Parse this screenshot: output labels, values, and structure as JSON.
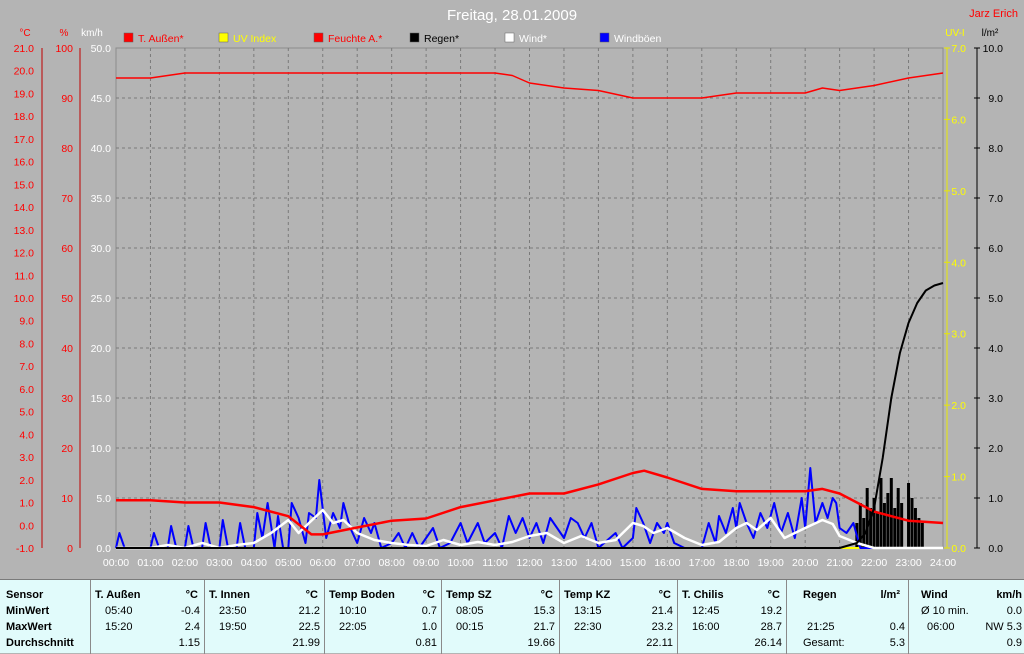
{
  "header": {
    "title": "Freitag, 28.01.2009",
    "author": "Jarz Erich"
  },
  "axes": {
    "temp_unit": "°C",
    "hum_unit": "%",
    "wind_unit": "km/h",
    "uv_unit": "UV-I",
    "rain_unit": "l/m²"
  },
  "chart_data": {
    "type": "line",
    "x": [
      "00:00",
      "01:00",
      "02:00",
      "03:00",
      "04:00",
      "05:00",
      "06:00",
      "07:00",
      "08:00",
      "09:00",
      "10:00",
      "11:00",
      "12:00",
      "13:00",
      "14:00",
      "15:00",
      "16:00",
      "17:00",
      "18:00",
      "19:00",
      "20:00",
      "21:00",
      "22:00",
      "23:00",
      "24:00"
    ],
    "temp_ticks": [
      "21.0",
      "20.0",
      "19.0",
      "18.0",
      "17.0",
      "16.0",
      "15.0",
      "14.0",
      "13.0",
      "12.0",
      "11.0",
      "10.0",
      "9.0",
      "8.0",
      "7.0",
      "6.0",
      "5.0",
      "4.0",
      "3.0",
      "2.0",
      "1.0",
      "0.0",
      "-1.0"
    ],
    "hum_ticks": [
      "100",
      "90",
      "80",
      "70",
      "60",
      "50",
      "40",
      "30",
      "20",
      "10",
      "0"
    ],
    "wind_ticks": [
      "50.0",
      "45.0",
      "40.0",
      "35.0",
      "30.0",
      "25.0",
      "20.0",
      "15.0",
      "10.0",
      "5.0",
      "0.0"
    ],
    "uv_ticks": [
      "7.0",
      "6.0",
      "5.0",
      "4.0",
      "3.0",
      "2.0",
      "1.0",
      "0.0"
    ],
    "rain_ticks": [
      "10.0",
      "9.0",
      "8.0",
      "7.0",
      "6.0",
      "5.0",
      "4.0",
      "3.0",
      "2.0",
      "1.0",
      "0.0"
    ],
    "ylim_wind": [
      0,
      50
    ],
    "ylim_temp": [
      -1,
      21
    ],
    "ylim_hum": [
      0,
      100
    ],
    "ylim_uv": [
      0,
      7
    ],
    "ylim_rain": [
      0,
      10
    ],
    "grid": true,
    "legend_position": "top",
    "series": [
      {
        "name": "T. Außen*",
        "color": "#ff0000",
        "axis": "temp",
        "points": [
          [
            0,
            1.1
          ],
          [
            1,
            1.1
          ],
          [
            2,
            1.0
          ],
          [
            3,
            1.0
          ],
          [
            4,
            0.8
          ],
          [
            5,
            0.4
          ],
          [
            5.67,
            -0.4
          ],
          [
            6,
            -0.4
          ],
          [
            7,
            -0.1
          ],
          [
            8,
            0.2
          ],
          [
            9,
            0.3
          ],
          [
            10,
            0.8
          ],
          [
            11,
            1.1
          ],
          [
            12,
            1.4
          ],
          [
            13,
            1.4
          ],
          [
            14,
            1.8
          ],
          [
            15,
            2.3
          ],
          [
            15.33,
            2.4
          ],
          [
            16,
            2.1
          ],
          [
            17,
            1.6
          ],
          [
            18,
            1.5
          ],
          [
            19,
            1.5
          ],
          [
            20,
            1.5
          ],
          [
            20.5,
            1.6
          ],
          [
            21,
            1.4
          ],
          [
            21.5,
            1.0
          ],
          [
            22,
            0.6
          ],
          [
            23,
            0.2
          ],
          [
            24,
            0.1
          ]
        ]
      },
      {
        "name": "UV Index",
        "color": "#ffff00",
        "axis": "uv",
        "points": [
          [
            0,
            0
          ],
          [
            24,
            0
          ]
        ]
      },
      {
        "name": "Feuchte A.*",
        "color": "#ff0000",
        "axis": "hum",
        "points": [
          [
            0,
            94
          ],
          [
            1,
            94
          ],
          [
            2,
            95
          ],
          [
            3,
            95
          ],
          [
            4,
            95
          ],
          [
            5,
            95
          ],
          [
            6,
            95
          ],
          [
            7,
            95
          ],
          [
            8,
            95
          ],
          [
            9,
            95
          ],
          [
            10,
            95
          ],
          [
            11,
            95
          ],
          [
            11.5,
            94.5
          ],
          [
            12,
            93
          ],
          [
            13,
            92
          ],
          [
            14,
            91.5
          ],
          [
            15,
            90
          ],
          [
            16,
            90
          ],
          [
            17,
            90
          ],
          [
            18,
            91
          ],
          [
            19,
            91
          ],
          [
            20,
            91
          ],
          [
            20.5,
            92
          ],
          [
            21,
            91.5
          ],
          [
            22,
            92.5
          ],
          [
            23,
            94
          ],
          [
            24,
            95
          ]
        ]
      },
      {
        "name": "Regen*",
        "color": "#000000",
        "axis": "rain",
        "points": [
          [
            0,
            0
          ],
          [
            21,
            0
          ],
          [
            21.5,
            0.1
          ],
          [
            21.75,
            0.3
          ],
          [
            22,
            0.8
          ],
          [
            22.25,
            1.8
          ],
          [
            22.5,
            3.0
          ],
          [
            22.75,
            3.9
          ],
          [
            23,
            4.5
          ],
          [
            23.25,
            4.9
          ],
          [
            23.5,
            5.15
          ],
          [
            23.75,
            5.25
          ],
          [
            24,
            5.3
          ]
        ]
      },
      {
        "name": "Wind*",
        "color": "#ffffff",
        "axis": "wind",
        "points": [
          [
            0,
            0
          ],
          [
            1,
            0
          ],
          [
            1.5,
            0.3
          ],
          [
            2,
            0
          ],
          [
            2.5,
            0.5
          ],
          [
            3,
            0
          ],
          [
            3.5,
            0.3
          ],
          [
            4,
            0.5
          ],
          [
            4.5,
            1.5
          ],
          [
            5,
            2.8
          ],
          [
            5.3,
            1.5
          ],
          [
            5.6,
            2.5
          ],
          [
            6,
            3.8
          ],
          [
            6.3,
            2.5
          ],
          [
            6.6,
            2.8
          ],
          [
            7,
            1.5
          ],
          [
            7.5,
            0.8
          ],
          [
            8,
            0.5
          ],
          [
            8.5,
            0.3
          ],
          [
            9,
            0.2
          ],
          [
            9.5,
            0.8
          ],
          [
            10,
            0.3
          ],
          [
            10.5,
            0.6
          ],
          [
            11,
            0.3
          ],
          [
            11.5,
            0.6
          ],
          [
            12,
            1.2
          ],
          [
            12.5,
            1.5
          ],
          [
            13,
            0.5
          ],
          [
            13.5,
            1.2
          ],
          [
            14,
            0.5
          ],
          [
            14.5,
            0.8
          ],
          [
            15,
            2.5
          ],
          [
            15.3,
            2.2
          ],
          [
            15.6,
            1.5
          ],
          [
            16,
            2.0
          ],
          [
            16.5,
            1.0
          ],
          [
            17,
            0.3
          ],
          [
            17.5,
            0.6
          ],
          [
            18,
            2.0
          ],
          [
            18.3,
            2.5
          ],
          [
            18.6,
            1.8
          ],
          [
            19,
            3.0
          ],
          [
            19.4,
            1.0
          ],
          [
            20,
            2.0
          ],
          [
            20.5,
            2.8
          ],
          [
            20.8,
            2.4
          ],
          [
            21,
            1.2
          ],
          [
            21.5,
            0.5
          ],
          [
            22,
            0
          ],
          [
            24,
            0
          ]
        ]
      },
      {
        "name": "Windböen",
        "color": "#0000ff",
        "axis": "wind",
        "points": [
          [
            0,
            0
          ],
          [
            0.1,
            1.5
          ],
          [
            0.25,
            0
          ],
          [
            1,
            0
          ],
          [
            1.1,
            1.5
          ],
          [
            1.25,
            0
          ],
          [
            1.5,
            0
          ],
          [
            1.6,
            2.2
          ],
          [
            1.75,
            0
          ],
          [
            2,
            0
          ],
          [
            2.1,
            2.2
          ],
          [
            2.25,
            0
          ],
          [
            2.5,
            0
          ],
          [
            2.6,
            2.5
          ],
          [
            2.75,
            0
          ],
          [
            3,
            0
          ],
          [
            3.1,
            2.8
          ],
          [
            3.25,
            0
          ],
          [
            3.5,
            0
          ],
          [
            3.6,
            2.5
          ],
          [
            3.75,
            0
          ],
          [
            4,
            0
          ],
          [
            4.1,
            3.5
          ],
          [
            4.25,
            1
          ],
          [
            4.4,
            4.5
          ],
          [
            4.6,
            0
          ],
          [
            4.7,
            3.2
          ],
          [
            4.85,
            0
          ],
          [
            5,
            0
          ],
          [
            5.1,
            4.5
          ],
          [
            5.3,
            3.0
          ],
          [
            5.5,
            0.5
          ],
          [
            5.6,
            3.5
          ],
          [
            5.8,
            3.0
          ],
          [
            5.9,
            6.8
          ],
          [
            6.1,
            1.0
          ],
          [
            6.3,
            3.5
          ],
          [
            6.5,
            2.0
          ],
          [
            6.6,
            4.5
          ],
          [
            6.8,
            2.0
          ],
          [
            7,
            0.5
          ],
          [
            7.2,
            3.0
          ],
          [
            7.4,
            1.5
          ],
          [
            7.5,
            2.5
          ],
          [
            7.7,
            0
          ],
          [
            8,
            0.5
          ],
          [
            8.2,
            1.5
          ],
          [
            8.4,
            0
          ],
          [
            8.6,
            1.5
          ],
          [
            8.8,
            0
          ],
          [
            9.2,
            2.0
          ],
          [
            9.4,
            0
          ],
          [
            9.7,
            0.5
          ],
          [
            10,
            2.5
          ],
          [
            10.2,
            0.5
          ],
          [
            10.5,
            2.5
          ],
          [
            10.7,
            0.5
          ],
          [
            11,
            1.5
          ],
          [
            11.2,
            0
          ],
          [
            11.4,
            3.2
          ],
          [
            11.6,
            1.5
          ],
          [
            11.8,
            3.0
          ],
          [
            12,
            1.0
          ],
          [
            12.2,
            2.5
          ],
          [
            12.4,
            0.5
          ],
          [
            12.6,
            3.0
          ],
          [
            12.8,
            2.0
          ],
          [
            13,
            1.0
          ],
          [
            13.2,
            3.0
          ],
          [
            13.4,
            2.5
          ],
          [
            13.6,
            1.0
          ],
          [
            13.8,
            2.5
          ],
          [
            14,
            0
          ],
          [
            14.5,
            1.5
          ],
          [
            14.7,
            0
          ],
          [
            15,
            1.0
          ],
          [
            15.1,
            4.0
          ],
          [
            15.3,
            2.5
          ],
          [
            15.5,
            0.5
          ],
          [
            15.7,
            2.5
          ],
          [
            15.9,
            1.5
          ],
          [
            16,
            2.5
          ],
          [
            16.2,
            0.5
          ],
          [
            16.5,
            0
          ],
          [
            17,
            0
          ],
          [
            17.2,
            2.5
          ],
          [
            17.4,
            0.5
          ],
          [
            17.5,
            3.2
          ],
          [
            17.7,
            1.5
          ],
          [
            17.9,
            4.0
          ],
          [
            18,
            2.0
          ],
          [
            18.1,
            4.5
          ],
          [
            18.3,
            2.5
          ],
          [
            18.5,
            1.0
          ],
          [
            18.7,
            3.5
          ],
          [
            18.9,
            2.0
          ],
          [
            19.1,
            4.5
          ],
          [
            19.3,
            1.5
          ],
          [
            19.5,
            3.5
          ],
          [
            19.7,
            1.0
          ],
          [
            19.9,
            5.0
          ],
          [
            20,
            2.0
          ],
          [
            20.15,
            8.0
          ],
          [
            20.3,
            2.5
          ],
          [
            20.5,
            4.5
          ],
          [
            20.65,
            3.0
          ],
          [
            20.8,
            5.0
          ],
          [
            20.9,
            4.5
          ],
          [
            21,
            2.0
          ],
          [
            21.2,
            1.5
          ],
          [
            21.4,
            2.5
          ],
          [
            21.6,
            0
          ],
          [
            24,
            0
          ]
        ]
      }
    ],
    "rain_bars": [
      [
        21.5,
        0.5
      ],
      [
        21.6,
        0.9
      ],
      [
        21.7,
        0.6
      ],
      [
        21.8,
        1.2
      ],
      [
        21.9,
        0.8
      ],
      [
        22.0,
        1.0
      ],
      [
        22.1,
        0.7
      ],
      [
        22.2,
        1.4
      ],
      [
        22.3,
        0.9
      ],
      [
        22.4,
        1.1
      ],
      [
        22.5,
        1.4
      ],
      [
        22.6,
        0.8
      ],
      [
        22.7,
        1.2
      ],
      [
        22.8,
        0.9
      ],
      [
        23.0,
        1.3
      ],
      [
        23.1,
        1.0
      ],
      [
        23.2,
        0.8
      ],
      [
        23.3,
        0.6
      ],
      [
        23.4,
        0.5
      ]
    ]
  },
  "summary": {
    "row_labels": [
      "Sensor",
      "MinWert",
      "MaxWert",
      "Durchschnitt"
    ],
    "columns": [
      {
        "name": "T. Außen",
        "unit": "°C",
        "min_time": "05:40",
        "min": "-0.4",
        "max_time": "15:20",
        "max": "2.4",
        "avg": "1.15"
      },
      {
        "name": "T. Innen",
        "unit": "°C",
        "min_time": "23:50",
        "min": "21.2",
        "max_time": "19:50",
        "max": "22.5",
        "avg": "21.99"
      },
      {
        "name": "Temp Boden",
        "unit": "°C",
        "min_time": "10:10",
        "min": "0.7",
        "max_time": "22:05",
        "max": "1.0",
        "avg": "0.81"
      },
      {
        "name": "Temp SZ",
        "unit": "°C",
        "min_time": "08:05",
        "min": "15.3",
        "max_time": "00:15",
        "max": "21.7",
        "avg": "19.66"
      },
      {
        "name": "Temp KZ",
        "unit": "°C",
        "min_time": "13:15",
        "min": "21.4",
        "max_time": "22:30",
        "max": "23.2",
        "avg": "22.11"
      },
      {
        "name": "T. Chilis",
        "unit": "°C",
        "min_time": "12:45",
        "min": "19.2",
        "max_time": "16:00",
        "max": "28.7",
        "avg": "26.14"
      }
    ],
    "rain": {
      "name": "Regen",
      "unit": "l/m²",
      "max_time": "21:25",
      "max": "0.4",
      "total_label": "Gesamt:",
      "total": "5.3"
    },
    "wind": {
      "name": "Wind",
      "unit": "km/h",
      "min_label": "Ø 10 min.",
      "min": "0.0",
      "max_time": "06:00",
      "max": "NW 5.3",
      "avg": "0.9"
    }
  }
}
